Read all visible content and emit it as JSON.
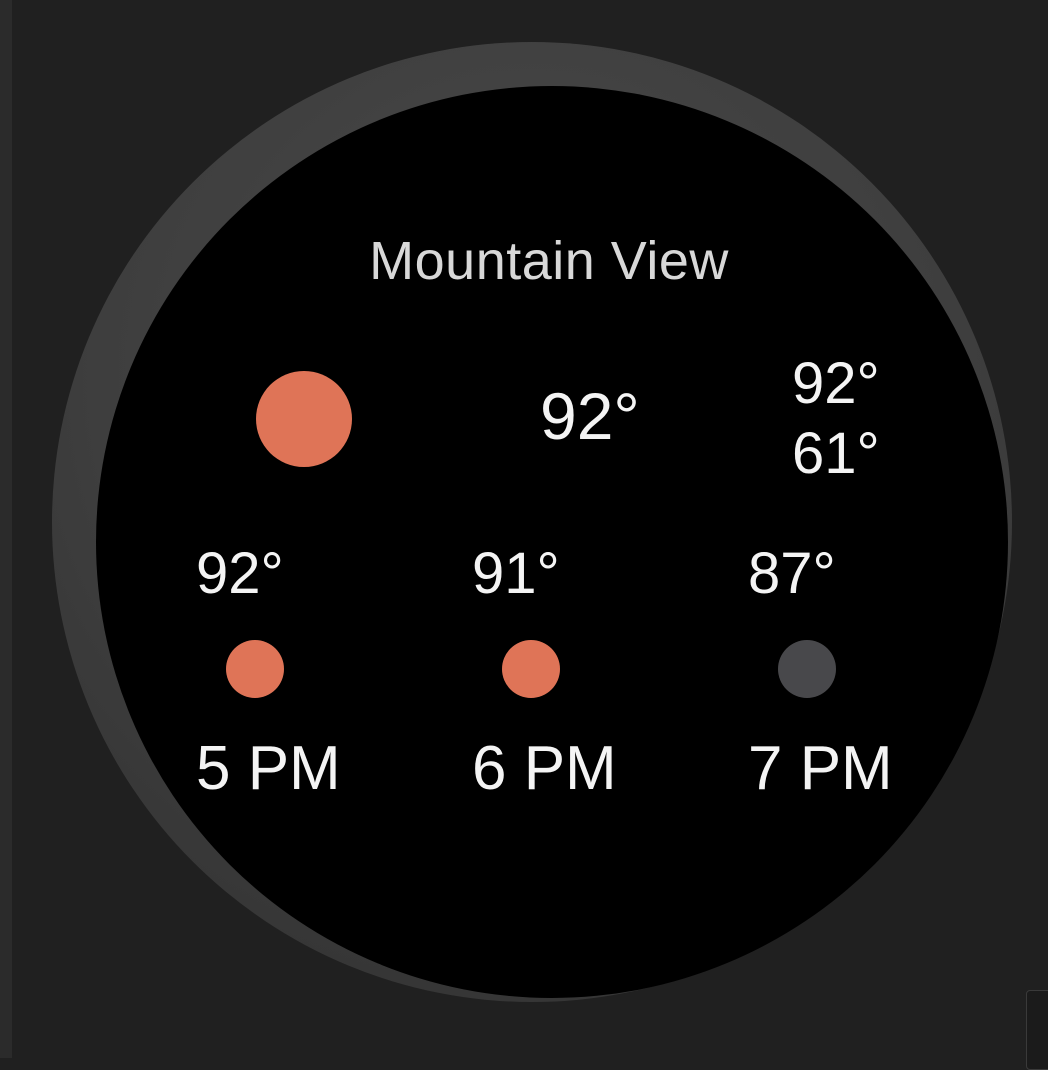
{
  "colors": {
    "sun": "#DF7457",
    "cloud": "#48484B"
  },
  "weather": {
    "location": "Mountain View",
    "current_icon": "sun-icon",
    "current_temp": "92°",
    "high_temp": "92°",
    "low_temp": "61°"
  },
  "hourly": [
    {
      "temp": "92°",
      "icon": "sun-icon",
      "time": "5 PM"
    },
    {
      "temp": "91°",
      "icon": "sun-icon",
      "time": "6 PM"
    },
    {
      "temp": "87°",
      "icon": "cloud-icon",
      "time": "7 PM"
    }
  ]
}
